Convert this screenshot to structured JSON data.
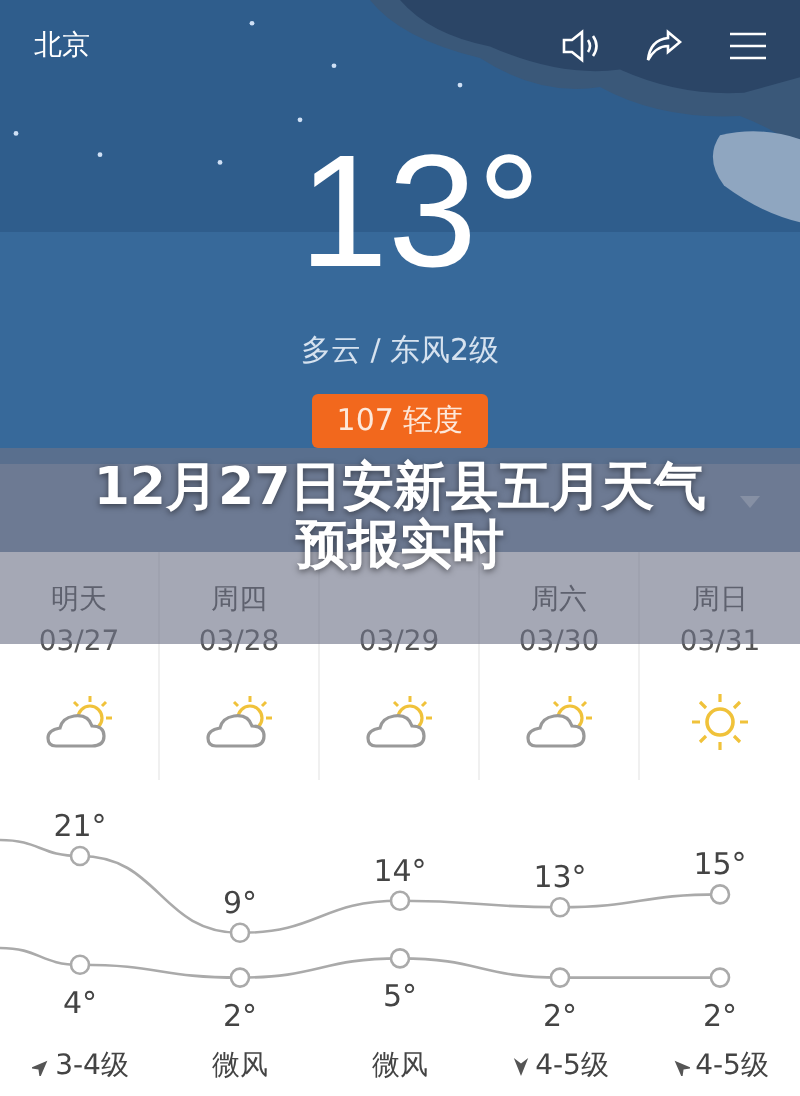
{
  "header": {
    "city": "北京",
    "temperature": "13°",
    "condition": "多云 / 东风2级",
    "aqi": "107 轻度"
  },
  "headline": "12月27日安新县五月天气预报实时",
  "forecast": [
    {
      "day": "明天",
      "date": "03/27",
      "kind": "partly-cloudy",
      "high": "21°",
      "low": "4°",
      "wind": {
        "text": "3-4级",
        "kind": "ne"
      }
    },
    {
      "day": "周四",
      "date": "03/28",
      "kind": "partly-cloudy",
      "high": "9°",
      "low": "2°",
      "wind": {
        "text": "微风",
        "kind": "calm"
      }
    },
    {
      "date": "03/29",
      "kind": "partly-cloudy",
      "high": "14°",
      "low": "5°",
      "wind": {
        "text": "微风",
        "kind": "calm"
      }
    },
    {
      "day": "周六",
      "date": "03/30",
      "kind": "partly-cloudy",
      "high": "13°",
      "low": "2°",
      "wind": {
        "text": "4-5级",
        "kind": "s"
      }
    },
    {
      "day": "周日",
      "date": "03/31",
      "kind": "sunny",
      "high": "15°",
      "low": "2°",
      "wind": {
        "text": "4-5级",
        "kind": "nw"
      }
    }
  ]
}
